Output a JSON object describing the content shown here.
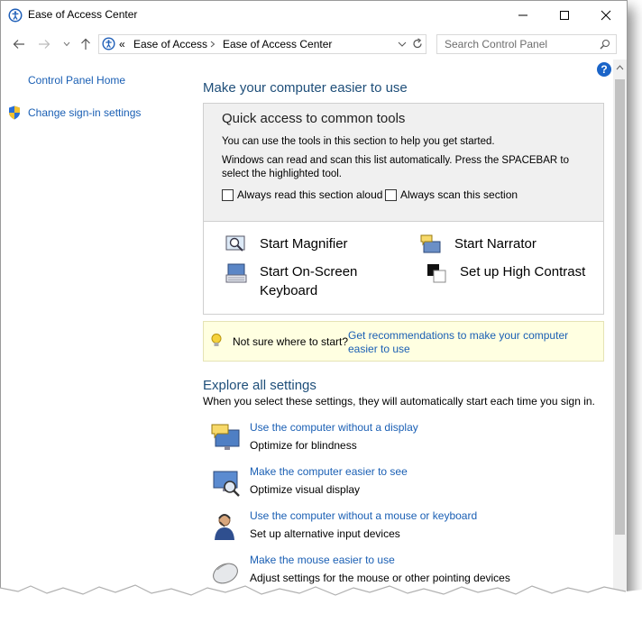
{
  "window": {
    "title": "Ease of Access Center"
  },
  "address": {
    "chevrons": "«",
    "crumbs": [
      "Ease of Access",
      "Ease of Access Center"
    ]
  },
  "search": {
    "placeholder": "Search Control Panel"
  },
  "leftnav": {
    "home": "Control Panel Home",
    "signin": "Change sign-in settings"
  },
  "main": {
    "heading": "Make your computer easier to use",
    "quick": {
      "title": "Quick access to common tools",
      "line1": "You can use the tools in this section to help you get started.",
      "line2": "Windows can read and scan this list automatically.  Press the SPACEBAR to select the highlighted tool.",
      "check1": "Always read this section aloud",
      "check2": "Always scan this section"
    },
    "tools": {
      "magnifier": "Start Magnifier",
      "narrator": "Start Narrator",
      "keyboard": "Start On-Screen Keyboard",
      "contrast": "Set up High Contrast"
    },
    "tip": {
      "text": "Not sure where to start?",
      "link": "Get recommendations to make your computer easier to use"
    },
    "explore": {
      "heading": "Explore all settings",
      "subtitle": "When you select these settings, they will automatically start each time you sign in.",
      "items": [
        {
          "title": "Use the computer without a display",
          "desc": "Optimize for blindness"
        },
        {
          "title": "Make the computer easier to see",
          "desc": "Optimize visual display"
        },
        {
          "title": "Use the computer without a mouse or keyboard",
          "desc": "Set up alternative input devices"
        },
        {
          "title": "Make the mouse easier to use",
          "desc": "Adjust settings for the mouse or other pointing devices"
        }
      ]
    }
  },
  "colors": {
    "link": "#1a5fb4",
    "heading": "#1e4e79",
    "tip_bg": "#ffffe1"
  }
}
